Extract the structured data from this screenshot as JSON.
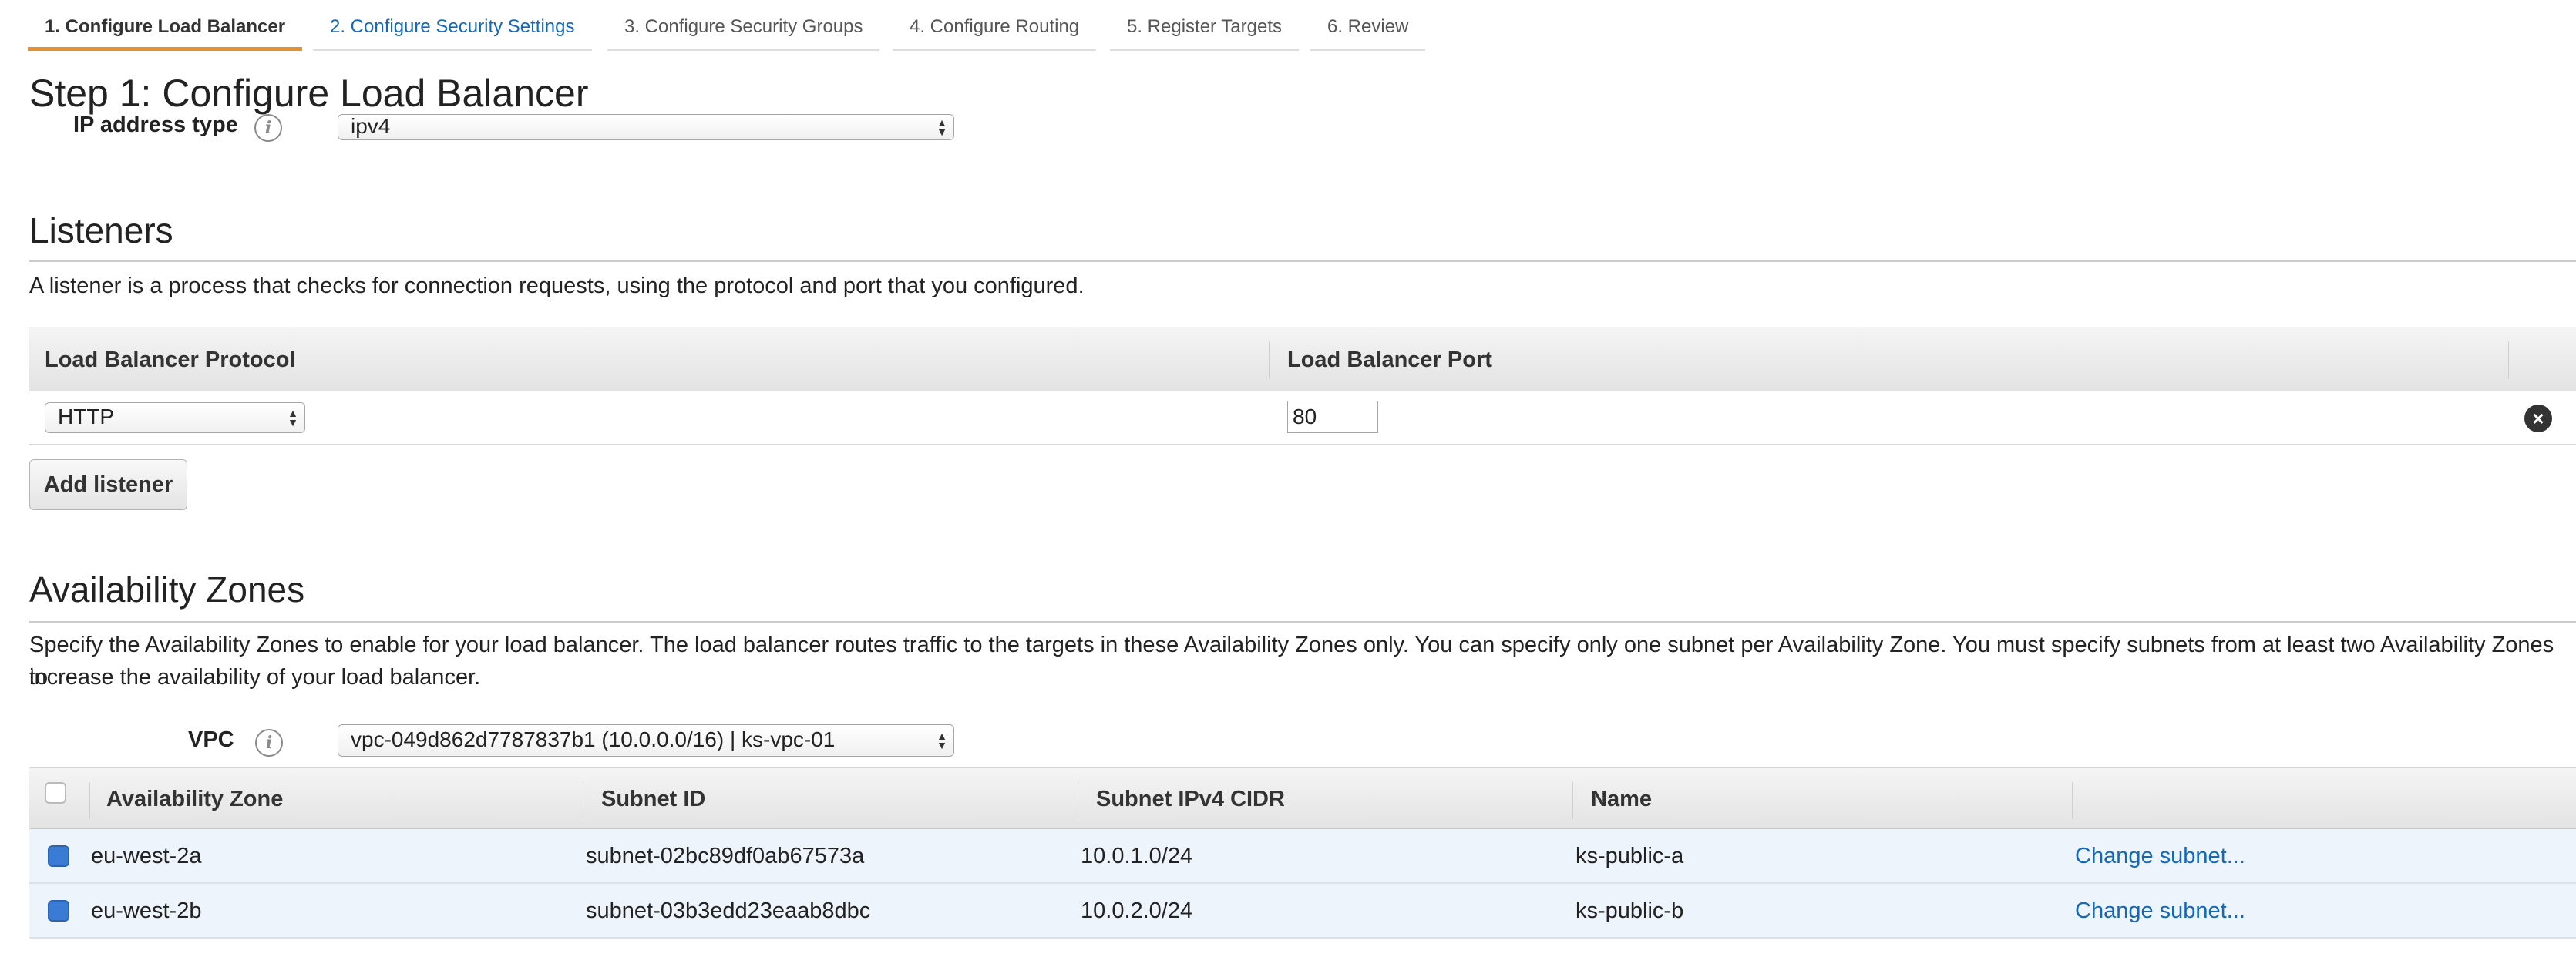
{
  "wizard": {
    "tabs": [
      "1. Configure Load Balancer",
      "2. Configure Security Settings",
      "3. Configure Security Groups",
      "4. Configure Routing",
      "5. Register Targets",
      "6. Review"
    ],
    "active_index": 0
  },
  "page": {
    "title": "Step 1: Configure Load Balancer"
  },
  "ip_address_type": {
    "label": "IP address type",
    "value": "ipv4"
  },
  "listeners": {
    "title": "Listeners",
    "description": "A listener is a process that checks for connection requests, using the protocol and port that you configured.",
    "columns": [
      "Load Balancer Protocol",
      "Load Balancer Port"
    ],
    "rows": [
      {
        "protocol": "HTTP",
        "port": "80"
      }
    ],
    "add_button": "Add listener"
  },
  "availability_zones": {
    "title": "Availability Zones",
    "description_line1": "Specify the Availability Zones to enable for your load balancer. The load balancer routes traffic to the targets in these Availability Zones only. You can specify only one subnet per Availability Zone. You must specify subnets from at least two Availability Zones to",
    "description_line2": "increase the availability of your load balancer.",
    "vpc_label": "VPC",
    "vpc_value": "vpc-049d862d7787837b1 (10.0.0.0/16) | ks-vpc-01",
    "columns": [
      "Availability Zone",
      "Subnet ID",
      "Subnet IPv4 CIDR",
      "Name"
    ],
    "rows": [
      {
        "checked": true,
        "zone": "eu-west-2a",
        "subnet_id": "subnet-02bc89df0ab67573a",
        "cidr": "10.0.1.0/24",
        "name": "ks-public-a",
        "action": "Change subnet..."
      },
      {
        "checked": true,
        "zone": "eu-west-2b",
        "subnet_id": "subnet-03b3edd23eaab8dbc",
        "cidr": "10.0.2.0/24",
        "name": "ks-public-b",
        "action": "Change subnet..."
      }
    ]
  },
  "colors": {
    "accent_orange": "#e7902d",
    "link_blue": "#1468b8",
    "checked_blue": "#3a7bd5"
  }
}
